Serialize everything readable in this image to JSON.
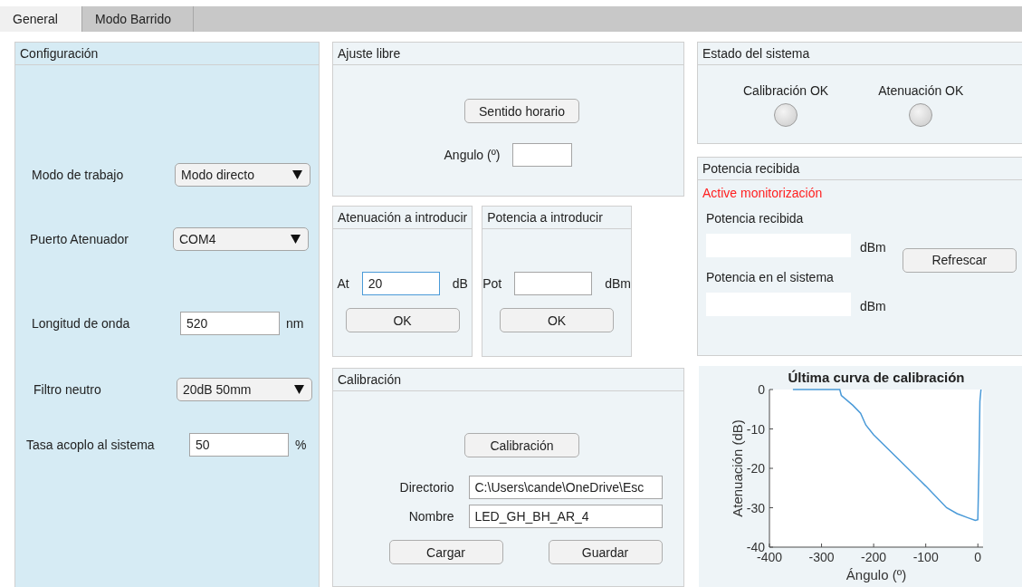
{
  "tabs": [
    {
      "label": "General",
      "selected": true
    },
    {
      "label": "Modo Barrido",
      "selected": false
    }
  ],
  "configuracion": {
    "title": "Configuración",
    "rows": [
      {
        "kind": "dropdown",
        "label": "Modo de trabajo",
        "value": "Modo directo"
      },
      {
        "kind": "dropdown",
        "label": "Puerto Atenuador",
        "value": "COM4"
      },
      {
        "kind": "field",
        "label": "Longitud de onda",
        "value": "520",
        "unit": "nm"
      },
      {
        "kind": "dropdown",
        "label": "Filtro neutro",
        "value": "20dB 50mm"
      },
      {
        "kind": "field",
        "label": "Tasa acoplo al sistema",
        "value": "50",
        "unit": "%"
      }
    ]
  },
  "ajuste_libre": {
    "title": "Ajuste libre",
    "button": "Sentido horario",
    "field_label": "Angulo (º)"
  },
  "inputs": [
    {
      "title": "Atenuación a introducir",
      "label": "At",
      "value": "20",
      "unit": "dB",
      "focused": true,
      "button": "OK"
    },
    {
      "title": "Potencia a introducir",
      "label": "Pot",
      "unit": "dBm",
      "focused": false,
      "button": "OK"
    }
  ],
  "calibracion": {
    "title": "Calibración",
    "button": "Calibración",
    "fields": [
      {
        "label": "Directorio",
        "value": "C:\\Users\\cande\\OneDrive\\Esc"
      },
      {
        "label": "Nombre",
        "value": "LED_GH_BH_AR_4"
      }
    ],
    "buttons": [
      "Cargar",
      "Guardar"
    ]
  },
  "estado": {
    "title": "Estado del sistema",
    "lamps": [
      {
        "label": "Calibración OK",
        "on": false
      },
      {
        "label": "Atenuación OK",
        "on": false
      }
    ]
  },
  "potencia_recibida": {
    "title": "Potencia recibida",
    "warning": "Active monitorización",
    "readings": [
      {
        "label": "Potencia recibida",
        "unit": "dBm"
      },
      {
        "label": "Potencia en el sistema",
        "unit": "dBm"
      }
    ],
    "button": "Refrescar"
  },
  "chart": {
    "chart_data": {
      "type": "line",
      "title": "Última curva de calibración",
      "xlabel": "Ángulo (º)",
      "ylabel": "Atenuación (dB)",
      "xlim": [
        -400,
        10
      ],
      "ylim": [
        -40,
        0
      ],
      "xticks": [
        -400,
        -300,
        -200,
        -100,
        0
      ],
      "yticks": [
        0,
        -10,
        -20,
        -30,
        -40
      ],
      "x": [
        -355,
        -265,
        -262,
        -240,
        -225,
        -215,
        -200,
        -150,
        -100,
        -60,
        -40,
        -20,
        -5,
        0,
        2,
        4,
        6
      ],
      "series": [
        {
          "color": "#4a9ad8",
          "values": [
            0,
            0,
            -1.5,
            -4,
            -6,
            -9,
            -11.5,
            -18,
            -24.5,
            -30,
            -31.5,
            -32.5,
            -33.2,
            -33,
            -20,
            -3,
            0
          ]
        }
      ]
    }
  }
}
